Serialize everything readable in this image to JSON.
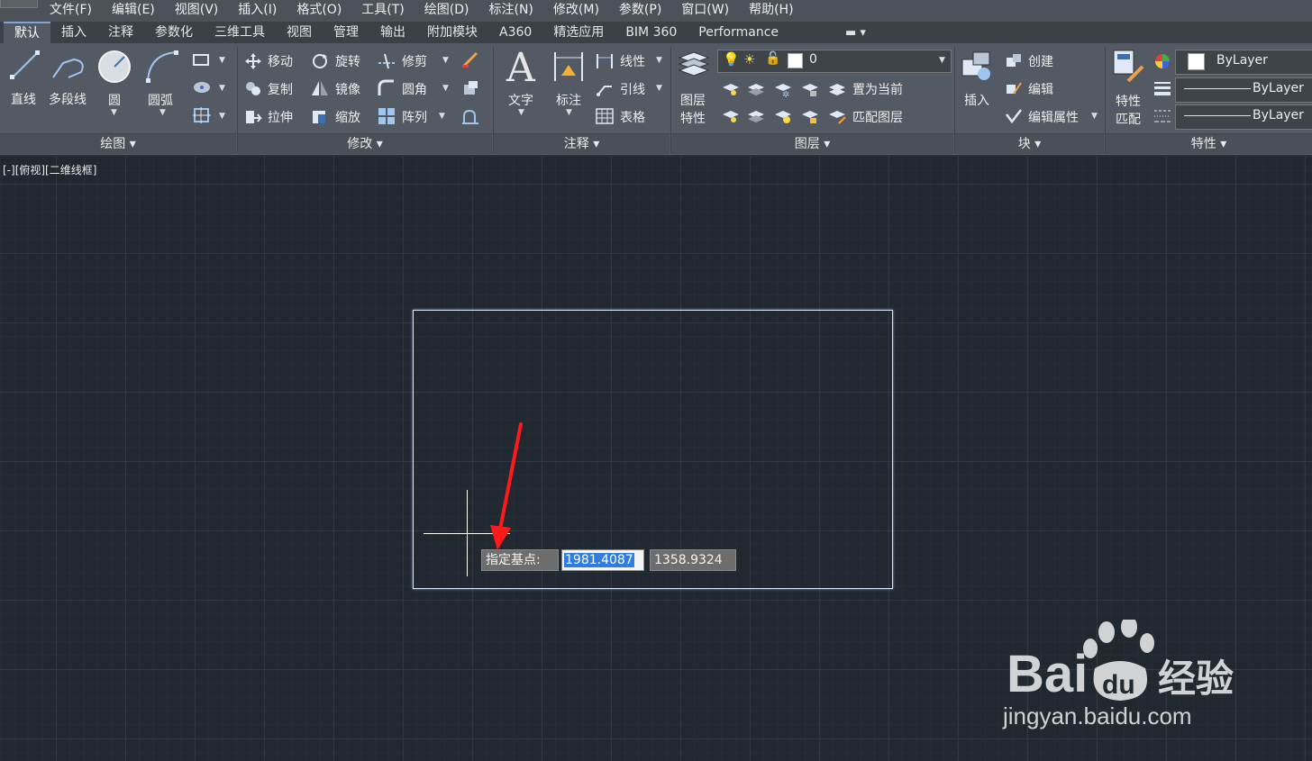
{
  "menu": [
    "文件(F)",
    "编辑(E)",
    "视图(V)",
    "插入(I)",
    "格式(O)",
    "工具(T)",
    "绘图(D)",
    "标注(N)",
    "修改(M)",
    "参数(P)",
    "窗口(W)",
    "帮助(H)"
  ],
  "tabs": [
    "默认",
    "插入",
    "注释",
    "参数化",
    "三维工具",
    "视图",
    "管理",
    "输出",
    "附加模块",
    "A360",
    "精选应用",
    "BIM 360",
    "Performance"
  ],
  "draw_panel": {
    "title": "绘图",
    "line": "直线",
    "polyline": "多段线",
    "circle": "圆",
    "arc": "圆弧"
  },
  "modify_panel": {
    "title": "修改",
    "move": "移动",
    "rotate": "旋转",
    "trim": "修剪",
    "copy": "复制",
    "mirror": "镜像",
    "fillet": "圆角",
    "stretch": "拉伸",
    "scale": "缩放",
    "array": "阵列"
  },
  "annotation_panel": {
    "title": "注释",
    "text": "文字",
    "dimension": "标注",
    "linear": "线性",
    "leader": "引线",
    "table": "表格"
  },
  "layer_panel": {
    "title": "图层",
    "layer_props_1": "图层",
    "layer_props_2": "特性",
    "layer_name": "0",
    "set_current": "置为当前",
    "match_layer": "匹配图层"
  },
  "block_panel": {
    "title": "块",
    "insert": "插入",
    "create": "创建",
    "edit": "编辑",
    "edit_attr": "编辑属性"
  },
  "properties_panel": {
    "title": "特性",
    "match_1": "特性",
    "match_2": "匹配",
    "color": "ByLayer",
    "linetype": "ByLayer",
    "lineweight": "ByLayer"
  },
  "viewport_label": "[-][俯视][二维线框]",
  "dynamic_input": {
    "prompt": "指定基点:",
    "x": "1981.4087",
    "y": "1358.9324"
  },
  "watermark": {
    "logo": "Bai du 经验",
    "url": "jingyan.baidu.com"
  },
  "colors": {
    "accent": "#2f7de0",
    "arrow": "#ff1a1a",
    "canvas": "#212830"
  }
}
